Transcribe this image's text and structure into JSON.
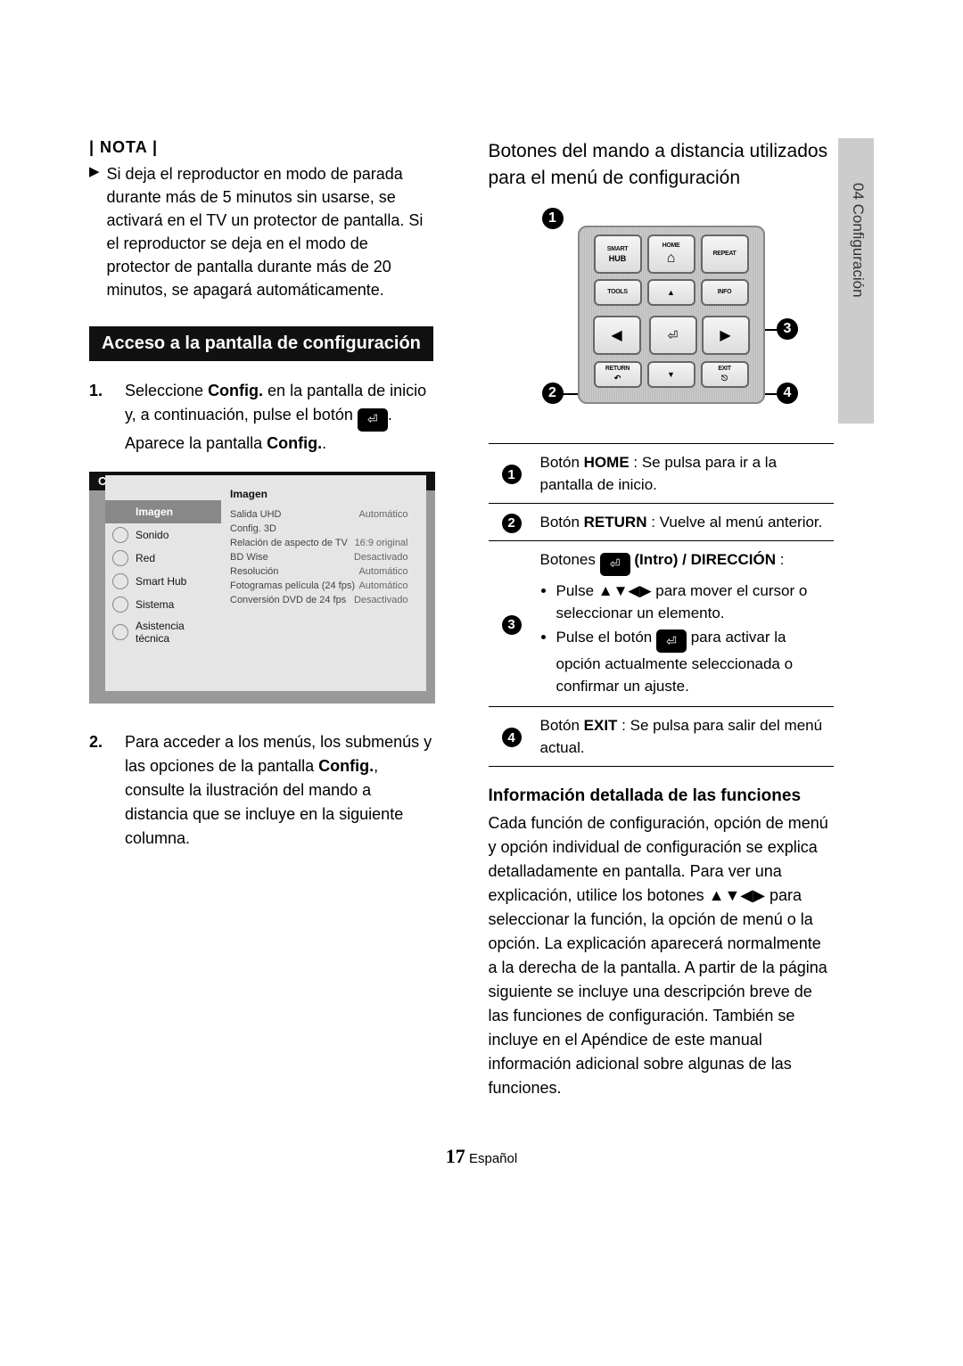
{
  "sideTab": "04  Configuración",
  "left": {
    "notaLabel": "| NOTA |",
    "notaMarker": "▶",
    "notaText": "Si deja el reproductor en modo de parada durante más de 5 minutos sin usarse, se activará en el TV un protector de pantalla. Si el reproductor se deja en el modo de protector de pantalla durante más de 20 minutos, se apagará automáticamente.",
    "sectionBar": "Acceso a la pantalla de configuración",
    "step1_num": "1.",
    "step1_a": "Seleccione ",
    "step1_b": "Config.",
    "step1_c": " en la pantalla de inicio y, a continuación, pulse el botón ",
    "step1_d": ". Aparece la pantalla ",
    "step1_e": "Config.",
    "step1_f": ".",
    "enterGlyph": "⏎",
    "config": {
      "title": "Config.",
      "heading": "Imagen",
      "side": [
        {
          "label": "Imagen",
          "active": true
        },
        {
          "label": "Sonido"
        },
        {
          "label": "Red"
        },
        {
          "label": "Smart Hub"
        },
        {
          "label": "Sistema"
        },
        {
          "label": "Asistencia técnica"
        }
      ],
      "rows": [
        {
          "name": "Salida UHD",
          "val": "Automático"
        },
        {
          "name": "Config. 3D",
          "val": ""
        },
        {
          "name": "Relación de aspecto de TV",
          "val": "16:9 original"
        },
        {
          "name": "BD Wise",
          "val": "Desactivado"
        },
        {
          "name": "Resolución",
          "val": "Automático"
        },
        {
          "name": "Fotogramas película (24 fps)",
          "val": "Automático"
        },
        {
          "name": "Conversión DVD de 24 fps",
          "val": "Desactivado"
        }
      ]
    },
    "step2_num": "2.",
    "step2_a": "Para acceder a los menús, los submenús y las opciones de la pantalla ",
    "step2_b": "Config.",
    "step2_c": ", consulte la ilustración del mando a distancia que se incluye en la siguiente columna."
  },
  "right": {
    "title": "Botones del mando a distancia utilizados para el menú de configuración",
    "remote": {
      "row1": [
        "SMART",
        "HOME",
        "REPEAT"
      ],
      "hub": "HUB",
      "tools": "TOOLS",
      "info": "INFO",
      "ret": "RETURN",
      "exit": "EXIT",
      "homeGlyph": "⌂",
      "retGlyph": "↶",
      "exitGlyph": "⎋",
      "up": "▲",
      "down": "▼",
      "left": "◀",
      "right": "▶",
      "center": "⏎"
    },
    "callouts": {
      "n1": "1",
      "n2": "2",
      "n3": "3",
      "n4": "4"
    },
    "tableRows": {
      "r1_a": "Botón ",
      "r1_b": "HOME",
      "r1_c": " : Se pulsa para ir a la pantalla de inicio.",
      "r2_a": "Botón ",
      "r2_b": "RETURN",
      "r2_c": " : Vuelve al menú anterior.",
      "r3_head_a": "Botones ",
      "r3_head_b": " (Intro) / DIRECCIÓN",
      "r3_head_c": " :",
      "r3_b1": "Pulse ▲▼◀▶ para mover el cursor o seleccionar un elemento.",
      "r3_b2_a": "Pulse el botón ",
      "r3_b2_b": " para activar la opción actualmente seleccionada o confirmar un ajuste.",
      "r4_a": "Botón ",
      "r4_b": "EXIT",
      "r4_c": " : Se pulsa para salir del menú actual."
    },
    "subHeading": "Información detallada de las funciones",
    "para": "Cada función de configuración, opción de menú y opción individual de configuración se explica detalladamente en pantalla. Para ver una explicación, utilice los botones ▲▼◀▶ para seleccionar la función, la opción de menú o la opción. La explicación aparecerá normalmente a la derecha de la pantalla. A partir de la página siguiente se incluye una descripción breve de las funciones de configuración. También se incluye en el Apéndice de este manual información adicional sobre algunas de las funciones."
  },
  "footer": {
    "num": "17",
    "lang": "Español"
  }
}
